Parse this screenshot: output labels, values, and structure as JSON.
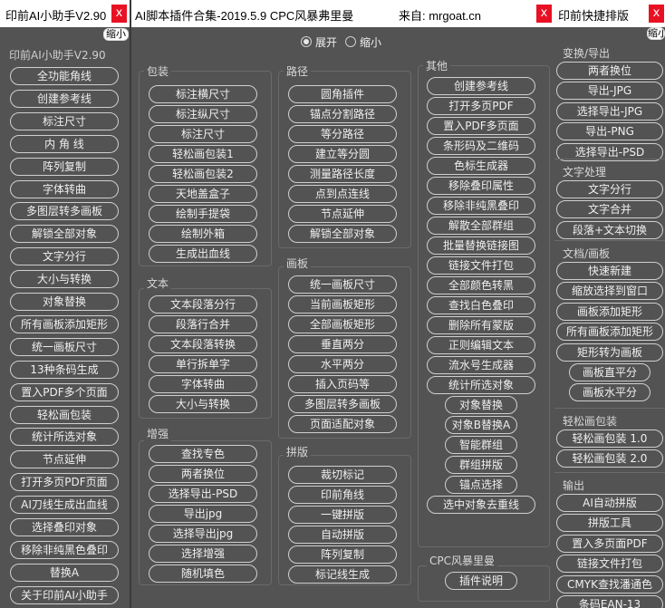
{
  "left_panel": {
    "title": "印前AI小助手V2.90",
    "close": "x",
    "shrink": "缩小",
    "subtitle": "印前AI小助手V2.90",
    "buttons": [
      "全功能角线",
      "创建参考线",
      "标注尺寸",
      "内 角 线",
      "阵列复制",
      "字体转曲",
      "多图层转多画板",
      "解锁全部对象",
      "文字分行",
      "大小与转换",
      "对象替换",
      "所有画板添加矩形",
      "统一画板尺寸",
      "13种条码生成",
      "置入PDF多个页面",
      "轻松画包装",
      "统计所选对象",
      "节点延伸",
      "打开多页PDF页面",
      "AI刀线生成出血线",
      "选择叠印对象",
      "移除非纯黑色叠印",
      "替换A",
      "关于印前AI小助手"
    ]
  },
  "middle_panel": {
    "title": "AI脚本插件合集-2019.5.9 CPC风暴弗里曼",
    "source": "来自: mrgoat.cn",
    "close": "x",
    "radio_expand": "展开",
    "radio_shrink": "缩小",
    "groups": {
      "baozhuang": {
        "label": "包装",
        "buttons": [
          "标注横尺寸",
          "标注纵尺寸",
          "标注尺寸",
          "轻松画包装1",
          "轻松画包装2",
          "天地盖盒子",
          "绘制手提袋",
          "绘制外箱",
          "生成出血线"
        ]
      },
      "wenben": {
        "label": "文本",
        "buttons": [
          "文本段落分行",
          "段落行合并",
          "文本段落转换",
          "单行拆单字",
          "字体转曲",
          "大小与转换"
        ]
      },
      "zengqiang": {
        "label": "增强",
        "buttons": [
          "查找专色",
          "两者换位",
          "选择导出-PSD",
          "导出jpg",
          "选择导出jpg",
          "选择增强",
          "随机填色"
        ]
      },
      "lujing": {
        "label": "路径",
        "buttons": [
          "圆角插件",
          "锚点分割路径",
          "等分路径",
          "建立等分圆",
          "测量路径长度",
          "点到点连线",
          "节点延伸",
          "解锁全部对象"
        ]
      },
      "huaban": {
        "label": "画板",
        "buttons": [
          "统一画板尺寸",
          "当前画板矩形",
          "全部画板矩形",
          "垂直两分",
          "水平两分",
          "插入页码等",
          "多图层转多画板",
          "页面适配对象"
        ]
      },
      "pinban": {
        "label": "拼版",
        "buttons": [
          "裁切标记",
          "印前角线",
          "一键拼版",
          "自动拼版",
          "阵列复制",
          "标记线生成"
        ]
      },
      "qita": {
        "label": "其他",
        "buttons": [
          "创建参考线",
          "打开多页PDF",
          "置入PDF多页面",
          "条形码及二维码",
          "色标生成器",
          "移除叠印属性",
          "移除非纯黑叠印",
          "解散全部群组",
          "批量替换链接图",
          "链接文件打包",
          "全部颜色转黑",
          "查找白色叠印",
          "删除所有蒙版",
          "正则编辑文本",
          "流水号生成器",
          "统计所选对象",
          "对象替换",
          "对象B替换A",
          "智能群组",
          "群组拼版",
          "锚点选择",
          "选中对象去重线"
        ]
      },
      "cpc": {
        "label": "CPC风暴里曼",
        "buttons": [
          "插件说明"
        ]
      }
    }
  },
  "right_panel": {
    "title": "印前快捷排版",
    "close": "x",
    "shrink": "缩小",
    "sections": [
      {
        "label": "变换/导出",
        "buttons": [
          "两者换位",
          "导出-JPG",
          "选择导出-JPG",
          "导出-PNG",
          "选择导出-PSD"
        ]
      },
      {
        "label": "文字处理",
        "buttons": [
          "文字分行",
          "文字合并",
          "段落+文本切换"
        ]
      },
      {
        "label": "文档/画板",
        "buttons": [
          "快速新建",
          "缩放选择到窗口",
          "画板添加矩形",
          "所有画板添加矩形",
          "矩形转为画板",
          "画板直平分",
          "画板水平分"
        ]
      },
      {
        "label": "轻松画包装",
        "buttons": [
          "轻松画包装 1.0",
          "轻松画包装 2.0"
        ]
      },
      {
        "label": "输出",
        "buttons": [
          "AI自动拼版",
          "拼版工具",
          "置入多页面PDF",
          "链接文件打包",
          "CMYK查找潘通色",
          "条码EAN-13"
        ]
      }
    ]
  }
}
